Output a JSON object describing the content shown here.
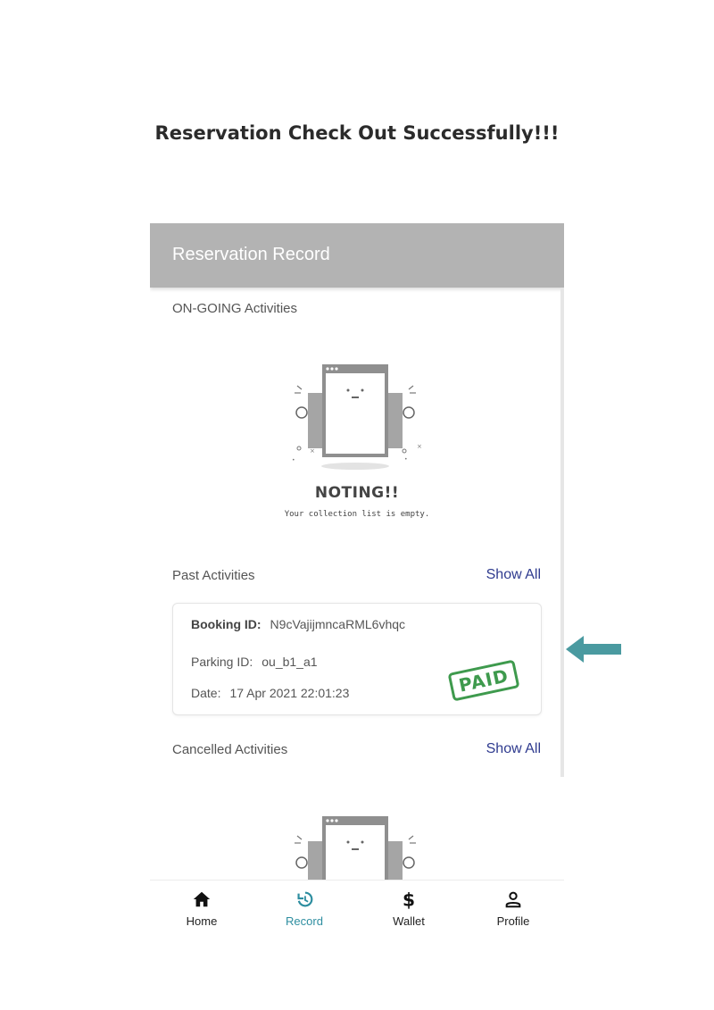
{
  "heading": "Reservation Check Out Successfully!!!",
  "app": {
    "title": "Reservation Record",
    "ongoing": {
      "label": "ON-GOING Activities",
      "empty_title": "NOTING!!",
      "empty_subtitle": "Your collection list is empty."
    },
    "past": {
      "label": "Past Activities",
      "show_all": "Show All",
      "record": {
        "booking_label": "Booking ID:",
        "booking_id": "N9cVajijmncaRML6vhqc",
        "parking_label": "Parking ID:",
        "parking_id": "ou_b1_a1",
        "date_label": "Date:",
        "date": "17 Apr 2021 22:01:23",
        "status_stamp": "PAID"
      }
    },
    "cancelled": {
      "label": "Cancelled Activities",
      "show_all": "Show All"
    }
  },
  "nav": {
    "items": [
      {
        "label": "Home",
        "icon": "home-icon"
      },
      {
        "label": "Record",
        "icon": "history-icon",
        "active": true
      },
      {
        "label": "Wallet",
        "icon": "dollar-icon"
      },
      {
        "label": "Profile",
        "icon": "person-icon"
      }
    ]
  },
  "colors": {
    "appbar": "#b3b3b3",
    "accent": "#2e8ea0",
    "link": "#2f3b8f",
    "paid_stamp": "#3e9a4d",
    "pointer_arrow": "#4a9aa0"
  }
}
